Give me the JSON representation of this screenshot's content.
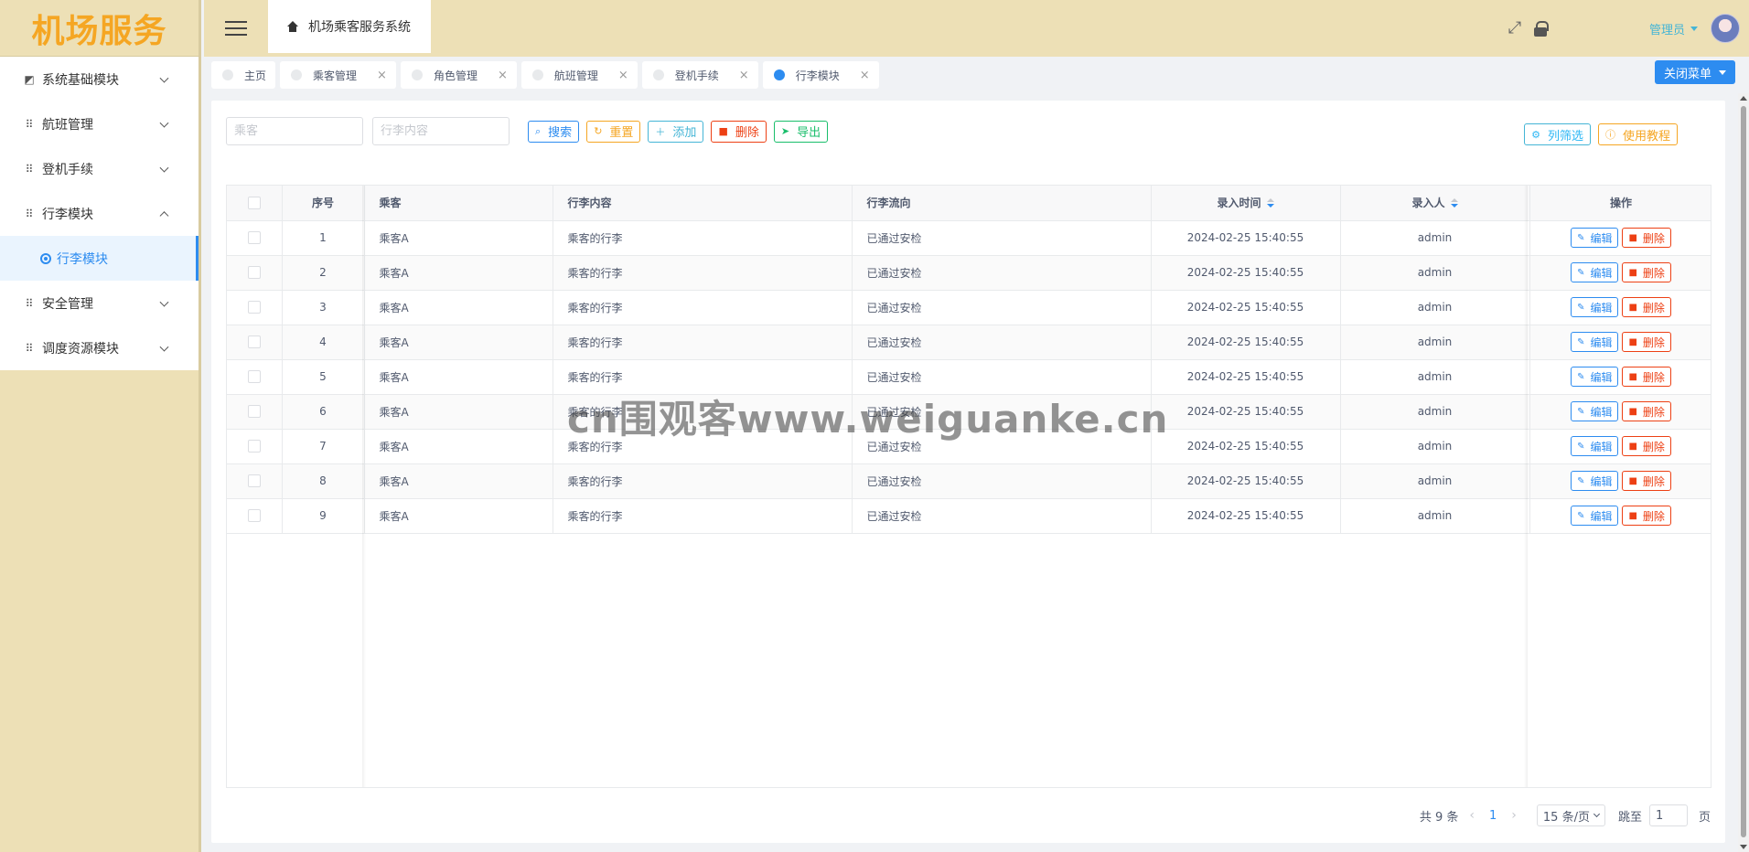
{
  "sidebar": {
    "logo": "机场服务",
    "items": [
      {
        "label": "系统基础模块",
        "icon": "chart-icon",
        "expanded": false
      },
      {
        "label": "航班管理",
        "icon": "grid-icon",
        "expanded": false
      },
      {
        "label": "登机手续",
        "icon": "grid-icon",
        "expanded": false
      },
      {
        "label": "行李模块",
        "icon": "grid-icon",
        "expanded": true
      },
      {
        "label": "安全管理",
        "icon": "grid-icon",
        "expanded": false
      },
      {
        "label": "调度资源模块",
        "icon": "grid-icon",
        "expanded": false
      }
    ],
    "active_sub": {
      "label": "行李模块",
      "icon": "target-icon"
    }
  },
  "header": {
    "breadcrumb": "机场乘客服务系统",
    "user_name": "管理员"
  },
  "tabs": [
    {
      "label": "主页",
      "closable": false,
      "active": false
    },
    {
      "label": "乘客管理",
      "closable": true,
      "active": false
    },
    {
      "label": "角色管理",
      "closable": true,
      "active": false
    },
    {
      "label": "航班管理",
      "closable": true,
      "active": false
    },
    {
      "label": "登机手续",
      "closable": true,
      "active": false
    },
    {
      "label": "行李模块",
      "closable": true,
      "active": true
    }
  ],
  "close_menu_label": "关闭菜单",
  "toolbar": {
    "passenger_placeholder": "乘客",
    "content_placeholder": "行李内容",
    "search": "搜索",
    "reset": "重置",
    "add": "添加",
    "delete": "删除",
    "export": "导出",
    "column_filter": "列筛选",
    "tutorial": "使用教程"
  },
  "table": {
    "headers": {
      "index": "序号",
      "passenger": "乘客",
      "content": "行李内容",
      "flow": "行李流向",
      "time": "录入时间",
      "by": "录入人",
      "ops": "操作"
    },
    "edit_label": "编辑",
    "delete_label": "删除",
    "rows": [
      {
        "index": "1",
        "passenger": "乘客A",
        "content": "乘客的行李",
        "flow": "已通过安检",
        "time": "2024-02-25 15:40:55",
        "by": "admin"
      },
      {
        "index": "2",
        "passenger": "乘客A",
        "content": "乘客的行李",
        "flow": "已通过安检",
        "time": "2024-02-25 15:40:55",
        "by": "admin"
      },
      {
        "index": "3",
        "passenger": "乘客A",
        "content": "乘客的行李",
        "flow": "已通过安检",
        "time": "2024-02-25 15:40:55",
        "by": "admin"
      },
      {
        "index": "4",
        "passenger": "乘客A",
        "content": "乘客的行李",
        "flow": "已通过安检",
        "time": "2024-02-25 15:40:55",
        "by": "admin"
      },
      {
        "index": "5",
        "passenger": "乘客A",
        "content": "乘客的行李",
        "flow": "已通过安检",
        "time": "2024-02-25 15:40:55",
        "by": "admin"
      },
      {
        "index": "6",
        "passenger": "乘客A",
        "content": "乘客的行李",
        "flow": "已通过安检",
        "time": "2024-02-25 15:40:55",
        "by": "admin"
      },
      {
        "index": "7",
        "passenger": "乘客A",
        "content": "乘客的行李",
        "flow": "已通过安检",
        "time": "2024-02-25 15:40:55",
        "by": "admin"
      },
      {
        "index": "8",
        "passenger": "乘客A",
        "content": "乘客的行李",
        "flow": "已通过安检",
        "time": "2024-02-25 15:40:55",
        "by": "admin"
      },
      {
        "index": "9",
        "passenger": "乘客A",
        "content": "乘客的行李",
        "flow": "已通过安检",
        "time": "2024-02-25 15:40:55",
        "by": "admin"
      }
    ]
  },
  "pager": {
    "total": "共 9 条",
    "current": "1",
    "page_size": "15 条/页",
    "jump_label": "跳至",
    "jump_value": "1",
    "page_unit": "页"
  },
  "watermark": "cn围观客www.weiguanke.cn",
  "colors": {
    "accent": "#2d8cf0",
    "sidebar_bg": "#ede0b6",
    "logo": "#f5a623",
    "danger": "#ed4014"
  }
}
